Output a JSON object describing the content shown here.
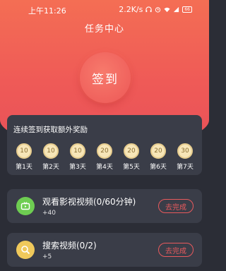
{
  "status_bar": {
    "time": "上午11:26",
    "net_speed": "2.2K/s",
    "battery": "66"
  },
  "header": {
    "title": "任务中心"
  },
  "signin": {
    "label": "签到"
  },
  "streak": {
    "title": "连续签到获取额外奖励",
    "days": [
      {
        "reward": "10",
        "label": "第1天"
      },
      {
        "reward": "10",
        "label": "第2天"
      },
      {
        "reward": "10",
        "label": "第3天"
      },
      {
        "reward": "20",
        "label": "第4天"
      },
      {
        "reward": "20",
        "label": "第5天"
      },
      {
        "reward": "20",
        "label": "第6天"
      },
      {
        "reward": "30",
        "label": "第7天"
      }
    ]
  },
  "tasks": [
    {
      "title": "观看影视视频(0/60分钟)",
      "reward": "+40",
      "button": "去完成",
      "icon": "tv-icon",
      "color": "#6ecd52"
    },
    {
      "title": "搜索视频(0/2)",
      "reward": "+5",
      "button": "去完成",
      "icon": "search-icon",
      "color": "#f0c95b"
    }
  ],
  "colors": {
    "accent": "#e95a5d",
    "header_gradient_top": "#f46e54",
    "background": "#2b2d36"
  }
}
